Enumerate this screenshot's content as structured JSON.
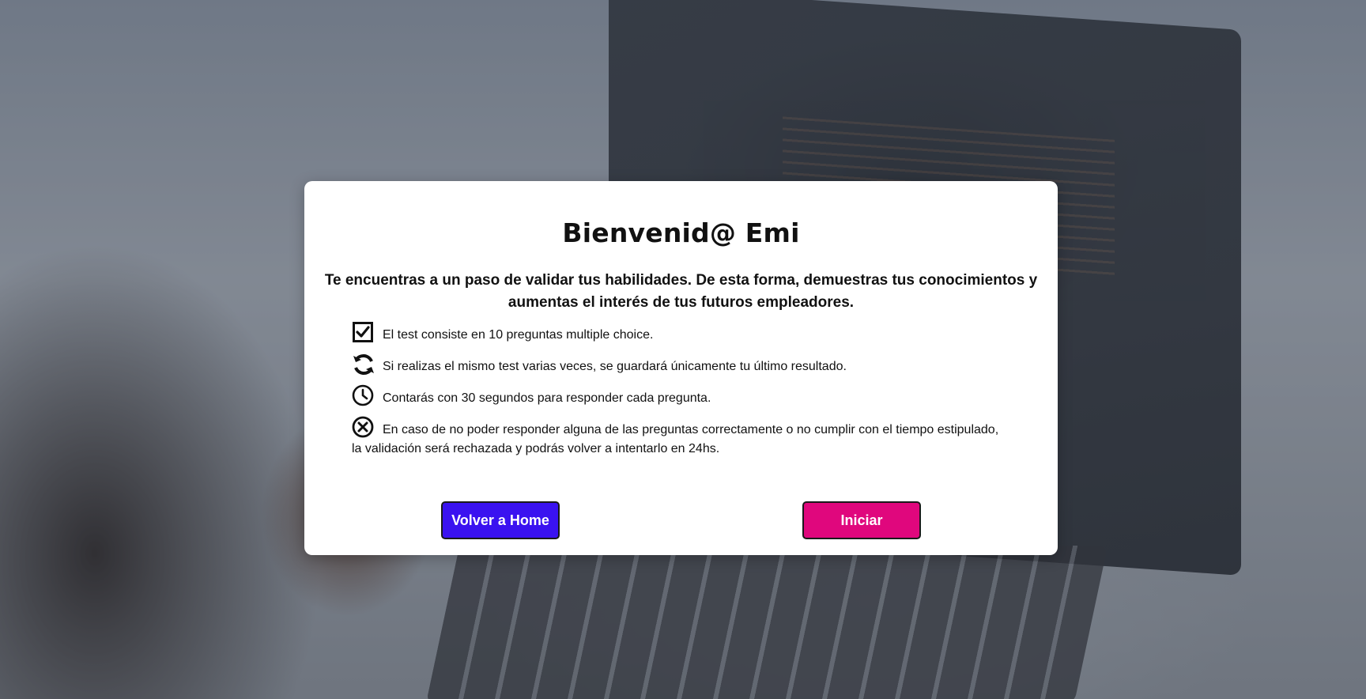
{
  "modal": {
    "title": "Bienvenid@ Emi",
    "lead": "Te encuentras a un paso de validar tus habilidades. De esta forma, demuestras tus conocimientos y aumentas el interés de tus futuros empleadores.",
    "rules": [
      {
        "icon": "checkbox-icon",
        "text": "El test consiste en 10 preguntas multiple choice."
      },
      {
        "icon": "refresh-icon",
        "text": "Si realizas el mismo test varias veces, se guardará únicamente tu último resultado."
      },
      {
        "icon": "clock-icon",
        "text": "Contarás con 30 segundos para responder cada pregunta."
      },
      {
        "icon": "close-circle-icon",
        "text": "En caso de no poder responder alguna de las preguntas correctamente o no cumplir con el tiempo estipulado, la validación será rechazada y podrás volver a intentarlo en 24hs."
      }
    ],
    "buttons": {
      "back_home": "Volver a Home",
      "start": "Iniciar"
    }
  },
  "colors": {
    "back_home_bg": "#3a12f0",
    "start_bg": "#e0077d",
    "modal_bg": "#ffffff"
  }
}
